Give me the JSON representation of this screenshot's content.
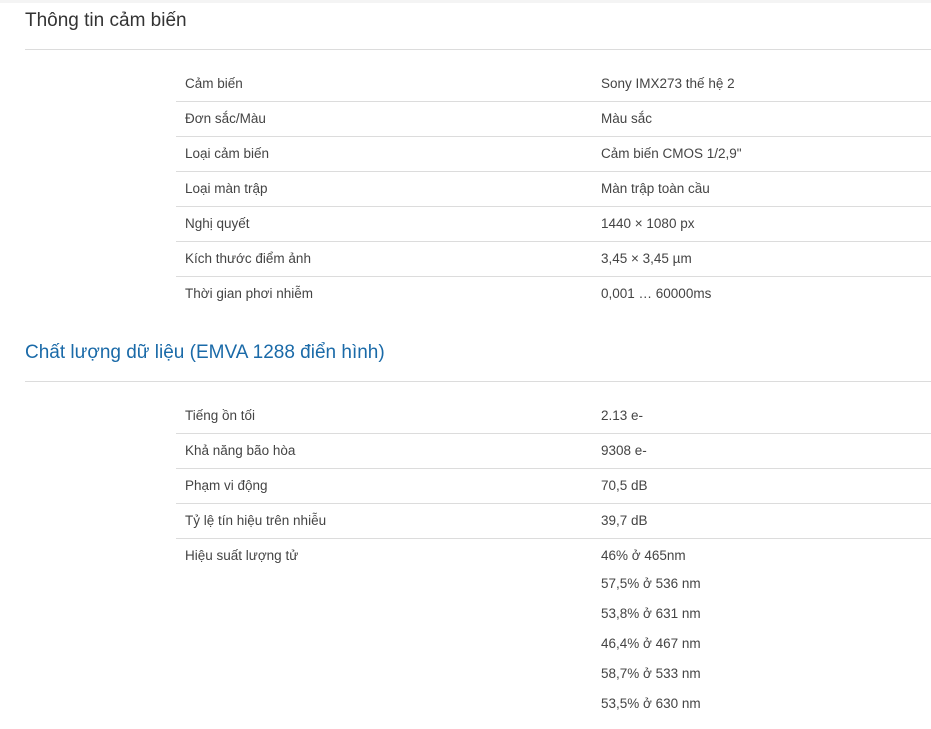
{
  "sensor_info": {
    "title": "Thông tin cảm biến",
    "rows": [
      {
        "label": "Cảm biến",
        "value": "Sony IMX273 thế hệ 2"
      },
      {
        "label": "Đơn sắc/Màu",
        "value": "Màu sắc"
      },
      {
        "label": "Loại cảm biến",
        "value": "Cảm biến CMOS 1/2,9\""
      },
      {
        "label": "Loại màn trập",
        "value": "Màn trập toàn cầu"
      },
      {
        "label": "Nghị quyết",
        "value": "1440 × 1080 px"
      },
      {
        "label": "Kích thước điểm ảnh",
        "value": "3,45 × 3,45 µm"
      },
      {
        "label": "Thời gian phơi nhiễm",
        "value": "0,001 … 60000ms"
      }
    ]
  },
  "data_quality": {
    "title": "Chất lượng dữ liệu (EMVA 1288 điển hình)",
    "rows": [
      {
        "label": "Tiếng ồn tối",
        "value": "2.13 e-"
      },
      {
        "label": "Khả năng bão hòa",
        "value": "9308 e-"
      },
      {
        "label": "Phạm vi động",
        "value": "70,5 dB"
      },
      {
        "label": "Tỷ lệ tín hiệu trên nhiễu",
        "value": "39,7 dB"
      }
    ],
    "quantum_efficiency": {
      "label": "Hiệu suất lượng tử",
      "values": [
        "46% ở 465nm",
        "57,5% ở 536 nm",
        "53,8% ở 631 nm",
        "46,4% ở 467 nm",
        "58,7% ở 533 nm",
        "53,5% ở 630 nm"
      ]
    }
  },
  "colors": {
    "section_title_blue": "#1a6aa8",
    "text": "#444444",
    "divider": "#dcdcdc"
  }
}
